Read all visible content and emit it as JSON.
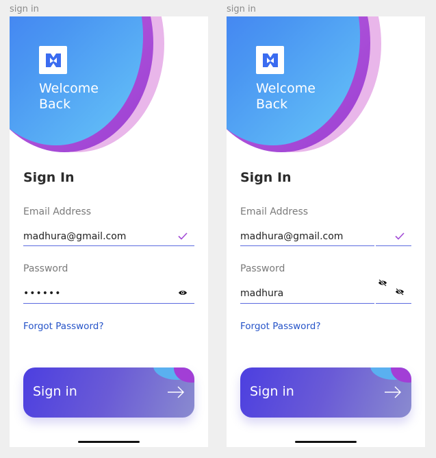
{
  "screens": [
    {
      "frame_label": "sign in",
      "welcome": "Welcome\nBack",
      "heading": "Sign In",
      "email_label": "Email Address",
      "email_value": "madhura@gmail.com",
      "password_label": "Password",
      "password_value": "••••••",
      "forgot": "Forgot Password?",
      "button_label": "Sign in"
    },
    {
      "frame_label": "sign in",
      "welcome": "Welcome\nBack",
      "heading": "Sign In",
      "email_label": "Email Address",
      "email_value": "madhura@gmail.com",
      "password_label": "Password",
      "password_value": "madhura",
      "forgot": "Forgot Password?",
      "button_label": "Sign in"
    }
  ],
  "colors": {
    "accent": "#5b6ae0",
    "link": "#2553c8",
    "check": "#a24ad6"
  },
  "icons": [
    "logo-icon",
    "check-icon",
    "eye-icon",
    "eye-off-icon",
    "arrow-right-icon"
  ]
}
